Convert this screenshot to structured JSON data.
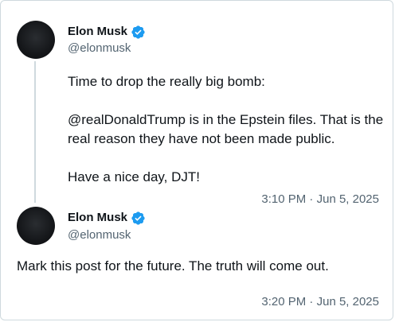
{
  "posts": [
    {
      "author": {
        "display_name": "Elon Musk",
        "handle": "@elonmusk",
        "verified": true,
        "verified_color": "#1d9bf0",
        "avatar_icon": "avatar"
      },
      "text": "Time to drop the really big bomb:\n\n@realDonaldTrump is in the Epstein files. That is the real reason they have not been made public.\n\nHave a nice day, DJT!",
      "timestamp": "3:10 PM · Jun 5, 2025"
    },
    {
      "author": {
        "display_name": "Elon Musk",
        "handle": "@elonmusk",
        "verified": true,
        "verified_color": "#1d9bf0",
        "avatar_icon": "avatar"
      },
      "text": "Mark this post for the future. The truth will come out.",
      "timestamp": "3:20 PM · Jun 5, 2025"
    }
  ]
}
